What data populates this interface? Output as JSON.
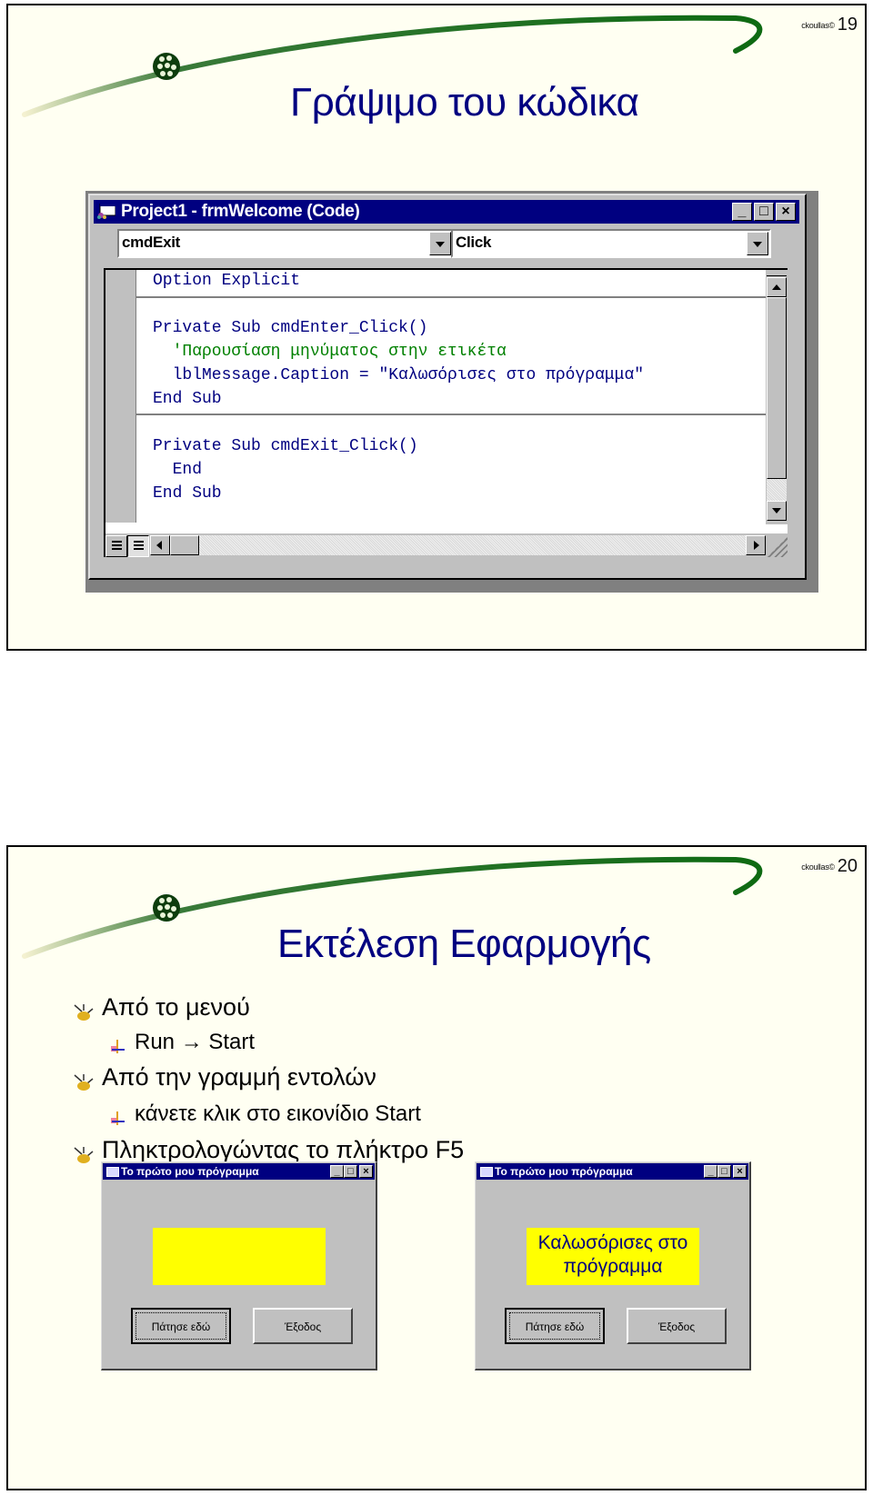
{
  "slides": [
    {
      "number": "19",
      "author": "ckoullas©",
      "title": "Γράψιμο του κώδικα",
      "code_window": {
        "title": "Project1 - frmWelcome (Code)",
        "object_combo": "cmdExit",
        "procedure_combo": "Click",
        "lines": [
          {
            "text": "Option Explicit",
            "kind": "code"
          },
          {
            "text": "Private Sub cmdEnter_Click()",
            "kind": "code"
          },
          {
            "text": "  'Παρουσίαση μηνύματος στην ετικέτα",
            "kind": "comment"
          },
          {
            "text": "  lblMessage.Caption = \"Καλωσόρισες στο πρόγραμμα\"",
            "kind": "code"
          },
          {
            "text": "End Sub",
            "kind": "code"
          },
          {
            "text": "Private Sub cmdExit_Click()",
            "kind": "code"
          },
          {
            "text": "  End",
            "kind": "code"
          },
          {
            "text": "End Sub",
            "kind": "code"
          }
        ],
        "window_buttons": {
          "minimize": "_",
          "maximize": "□",
          "close": "×"
        }
      }
    },
    {
      "number": "20",
      "author": "ckoullas©",
      "title": "Εκτέλεση Εφαρμογής",
      "bullets": [
        {
          "level": 1,
          "text": "Από το μενού"
        },
        {
          "level": 2,
          "text": "Run → Start"
        },
        {
          "level": 1,
          "text": "Από την γραμμή εντολών"
        },
        {
          "level": 2,
          "text": "κάνετε κλικ στο εικονίδιο Start"
        },
        {
          "level": 1,
          "text": "Πληκτρολογώντας το πλήκτρο F5"
        }
      ],
      "forms": [
        {
          "title": "Το πρώτο μου πρόγραμμα",
          "label_text": "",
          "enter_button": "Πάτησε εδώ",
          "exit_button": "Έξοδος"
        },
        {
          "title": "Το πρώτο μου πρόγραμμα",
          "label_text": "Καλωσόρισες στο πρόγραμμα",
          "enter_button": "Πάτησε εδώ",
          "exit_button": "Έξοδος"
        }
      ]
    }
  ],
  "colors": {
    "title_blue": "#000080",
    "slide_bg": "#fffff2",
    "swoosh_green": "#1e7a1e",
    "vb_gray": "#c0c0c0",
    "label_yellow": "#ffff00",
    "comment_green": "#008000"
  }
}
